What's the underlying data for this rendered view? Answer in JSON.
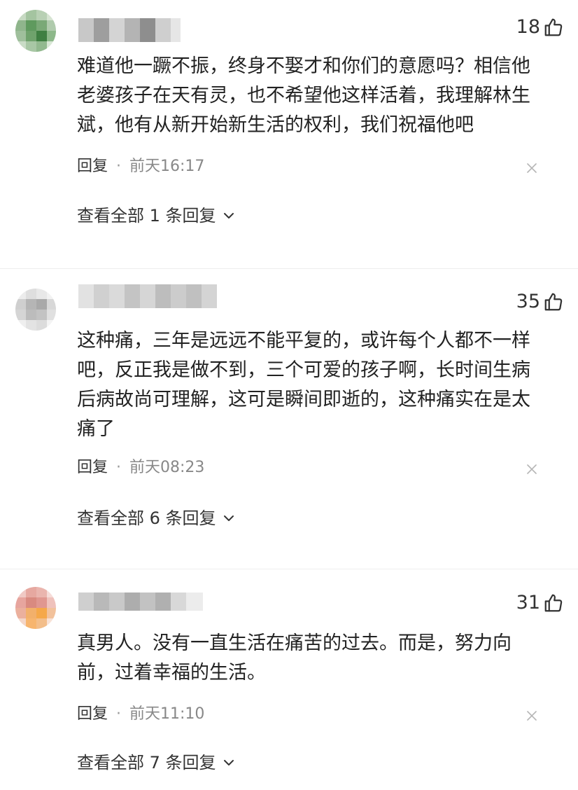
{
  "comments": [
    {
      "likes": "18",
      "text": "难道他一蹶不振，终身不娶才和你们的意愿吗？相信他老婆孩子在天有灵，也不希望他这样活着，我理解林生斌，他有从新开始新生活的权利，我们祝福他吧",
      "reply_label": "回复",
      "separator": "·",
      "time": "前天16:17",
      "view_replies": "查看全部 1 条回复"
    },
    {
      "likes": "35",
      "text": "这种痛，三年是远远不能平复的，或许每个人都不一样吧，反正我是做不到，三个可爱的孩子啊，长时间生病后病故尚可理解，这可是瞬间即逝的，这种痛实在是太痛了",
      "reply_label": "回复",
      "separator": "·",
      "time": "前天08:23",
      "view_replies": "查看全部 6 条回复"
    },
    {
      "likes": "31",
      "text": "真男人。没有一直生活在痛苦的过去。而是，努力向前，过着幸福的生活。",
      "reply_label": "回复",
      "separator": "·",
      "time": "前天11:10",
      "view_replies": "查看全部 7 条回复"
    }
  ],
  "icons": {
    "like": "thumbs-up-icon",
    "dismiss": "close-icon",
    "expand": "chevron-down-icon"
  }
}
